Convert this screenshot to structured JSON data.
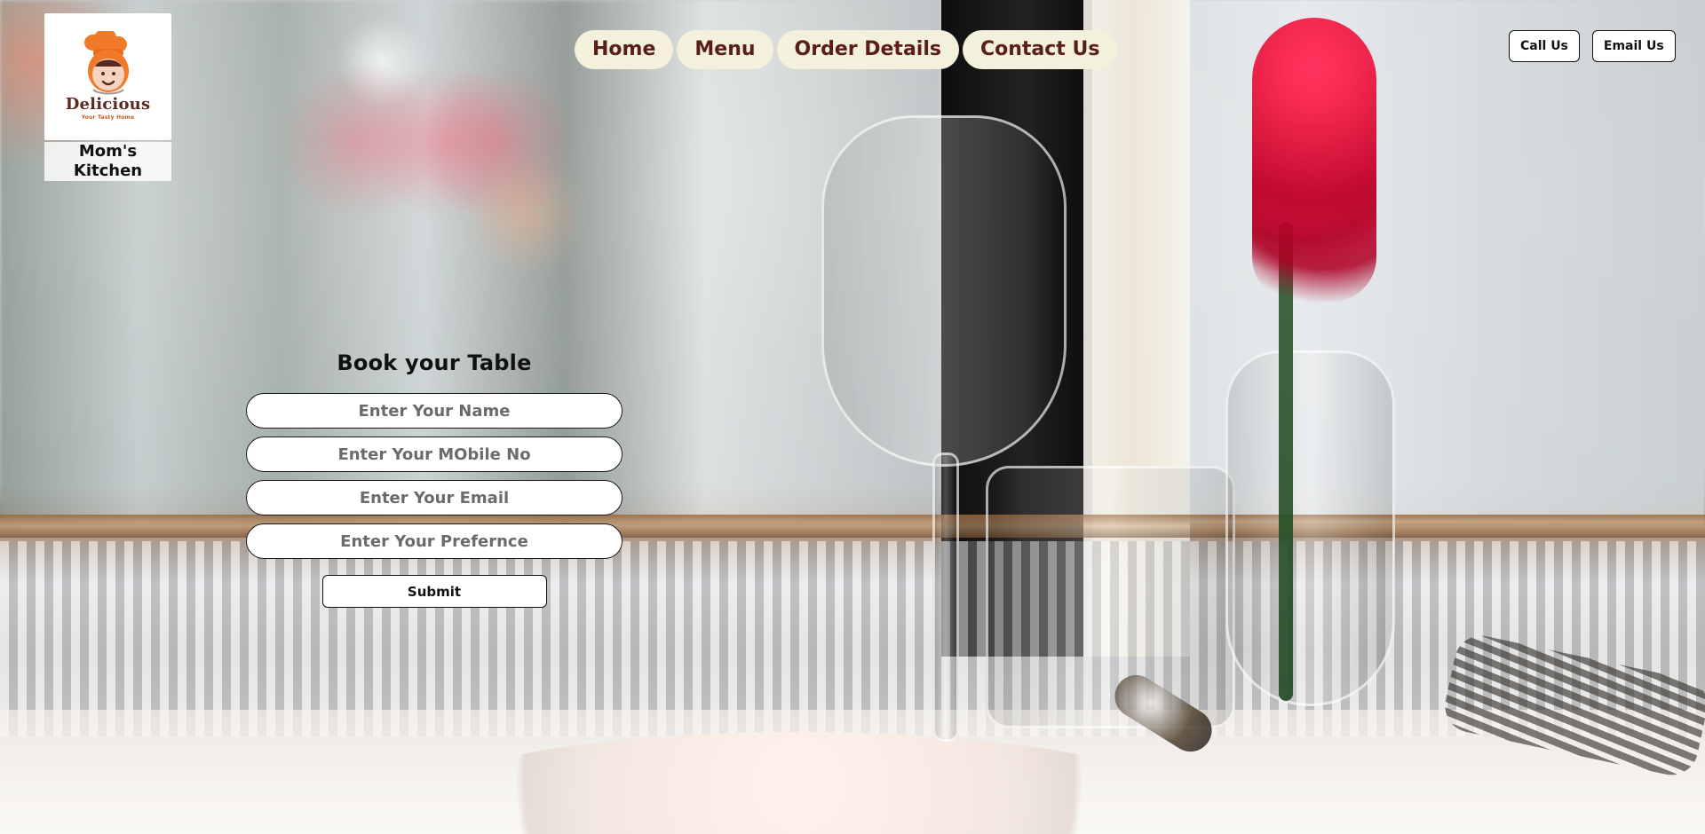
{
  "brand": {
    "logo": {
      "title": "Delicious",
      "tagline": "Your Tasty Home"
    },
    "name": "Mom's Kitchen"
  },
  "nav": {
    "items": [
      {
        "label": "Home"
      },
      {
        "label": "Menu"
      },
      {
        "label": "Order Details"
      },
      {
        "label": "Contact Us"
      }
    ]
  },
  "top_actions": {
    "call_label": "Call Us",
    "email_label": "Email Us"
  },
  "booking": {
    "title": "Book your Table",
    "fields": {
      "name_placeholder": "Enter Your Name",
      "mobile_placeholder": "Enter Your MObile No",
      "email_placeholder": "Enter Your Email",
      "preference_placeholder": "Enter Your Prefernce"
    },
    "submit_label": "Submit"
  },
  "colors": {
    "nav_bg": "#f3f0db",
    "nav_text": "#5a1d17"
  }
}
